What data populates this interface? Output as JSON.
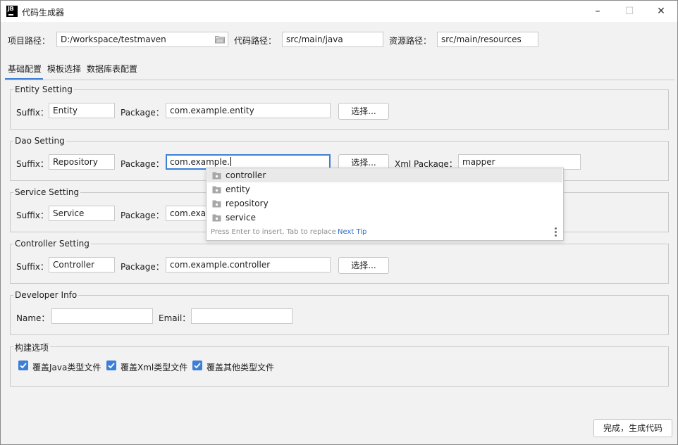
{
  "window": {
    "title": "代码生成器",
    "minimize": "–",
    "maximize": "☐",
    "close": "✕"
  },
  "paths": {
    "project_label": "项目路径：",
    "project_value": "D:/workspace/testmaven",
    "code_label": "代码路径：",
    "code_value": "src/main/java",
    "resource_label": "资源路径：",
    "resource_value": "src/main/resources"
  },
  "tabs": [
    "基础配置",
    "模板选择",
    "数据库表配置"
  ],
  "labels": {
    "suffix": "Suffix：",
    "package": "Package：",
    "xml_package": "Xml Package：",
    "name": "Name：",
    "email": "Email：",
    "choose": "选择..."
  },
  "entity": {
    "title": "Entity Setting",
    "suffix": "Entity",
    "package": "com.example.entity"
  },
  "dao": {
    "title": "Dao Setting",
    "suffix": "Repository",
    "package": "com.example.",
    "xml_package": "mapper"
  },
  "service": {
    "title": "Service Setting",
    "suffix": "Service",
    "package": "com.exam"
  },
  "controller": {
    "title": "Controller Setting",
    "suffix": "Controller",
    "package": "com.example.controller"
  },
  "developer": {
    "title": "Developer Info",
    "name": "",
    "email": ""
  },
  "build": {
    "title": "构建选项",
    "options": [
      {
        "label": "覆盖Java类型文件",
        "checked": true
      },
      {
        "label": "覆盖Xml类型文件",
        "checked": true
      },
      {
        "label": "覆盖其他类型文件",
        "checked": true
      }
    ]
  },
  "completion": {
    "items": [
      "controller",
      "entity",
      "repository",
      "service"
    ],
    "selected_index": 0,
    "hint": "Press Enter to insert, Tab to replace",
    "next_tip": "Next Tip"
  },
  "footer": {
    "finish_button": "完成，生成代码"
  },
  "colors": {
    "accent": "#3d7fd6",
    "background": "#f2f2f2",
    "field_border": "#c9c9c9"
  }
}
